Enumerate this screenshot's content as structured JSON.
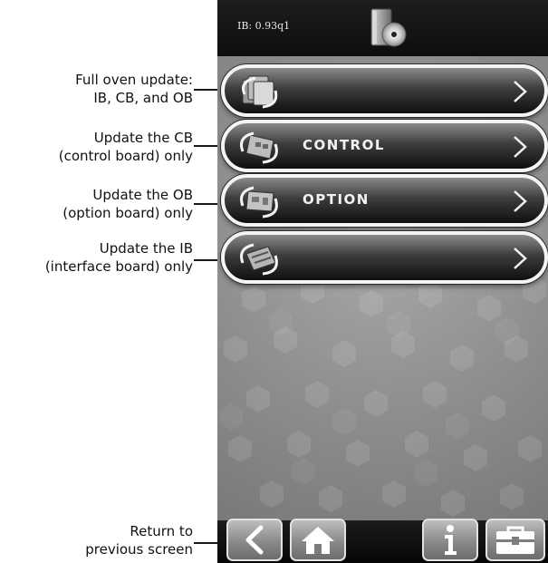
{
  "callouts": {
    "full_update": [
      "Full oven update:",
      "IB, CB, and OB"
    ],
    "update_cb": [
      "Update the CB",
      "(control board) only"
    ],
    "update_ob": [
      "Update the OB",
      "(option board) only"
    ],
    "update_ib": [
      "Update the IB",
      "(interface board) only"
    ],
    "return_prev": [
      "Return to",
      "previous screen"
    ]
  },
  "header": {
    "version": "IB: 0.93q1",
    "icon": "software-disc-icon"
  },
  "menu": [
    {
      "label": "",
      "icon": "full-oven-boards-icon"
    },
    {
      "label": "CONTROL",
      "icon": "control-board-icon"
    },
    {
      "label": "OPTION",
      "icon": "option-board-icon"
    },
    {
      "label": "",
      "icon": "interface-board-icon"
    }
  ],
  "bottom_bar": {
    "back": "back-arrow-icon",
    "home": "home-icon",
    "info": "info-icon",
    "toolbox": "toolbox-icon"
  }
}
